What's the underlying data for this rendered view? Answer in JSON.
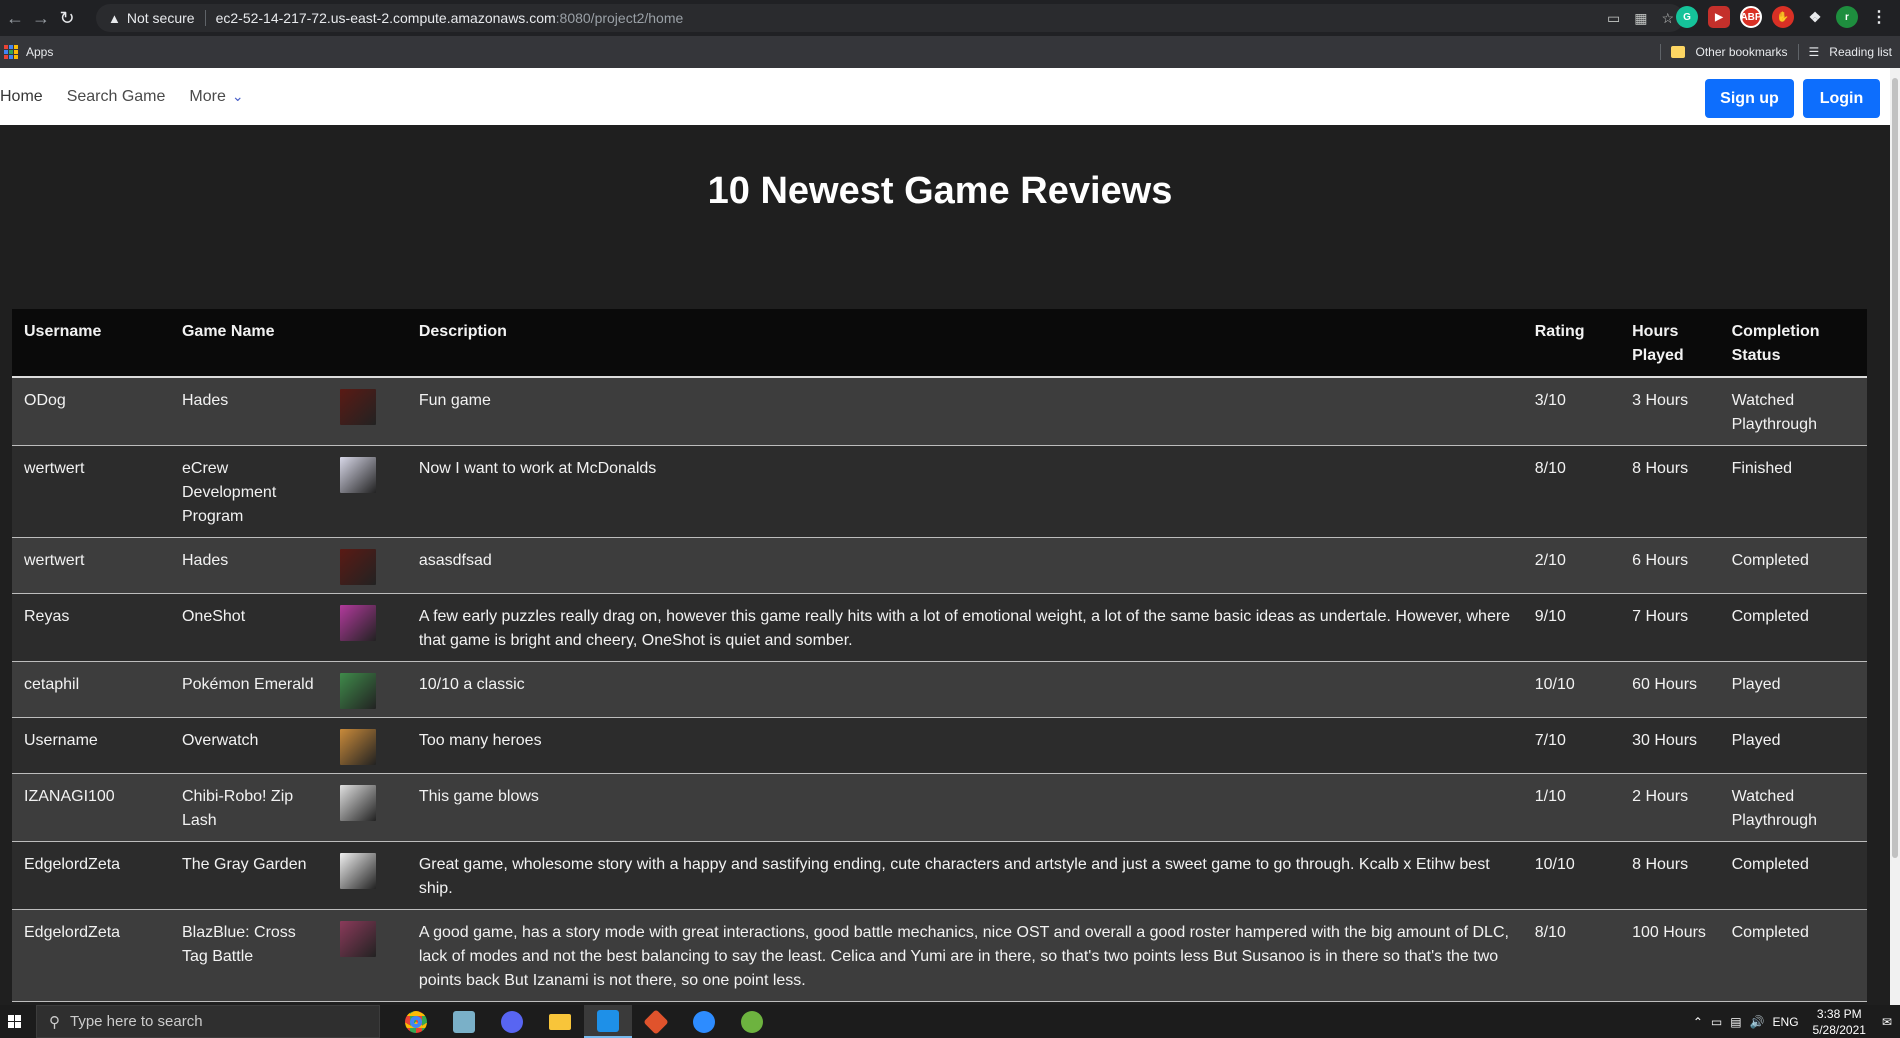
{
  "browser": {
    "security_label": "Not secure",
    "url_host": "ec2-52-14-217-72.us-east-2.compute.amazonaws.com",
    "url_path": ":8080/project2/home",
    "bookmarks_apps": "Apps",
    "other_bookmarks": "Other bookmarks",
    "reading_list": "Reading list"
  },
  "navbar": {
    "home": "Home",
    "search_game": "Search Game",
    "more": "More",
    "signup": "Sign up",
    "login": "Login"
  },
  "page": {
    "title": "10 Newest Game Reviews"
  },
  "table": {
    "headers": {
      "username": "Username",
      "game_name": "Game Name",
      "description": "Description",
      "rating": "Rating",
      "hours_played": "Hours Played",
      "completion_status": "Completion Status"
    },
    "rows": [
      {
        "username": "ODog",
        "game": "Hades",
        "description": "Fun game",
        "rating": "3/10",
        "hours": "3 Hours",
        "status": "Watched Playthrough",
        "thumb_color": "#5a1a14"
      },
      {
        "username": "wertwert",
        "game": "eCrew Development Program",
        "description": "Now I want to work at McDonalds",
        "rating": "8/10",
        "hours": "8 Hours",
        "status": "Finished",
        "thumb_color": "#d8d8e8"
      },
      {
        "username": "wertwert",
        "game": "Hades",
        "description": "asasdfsad",
        "rating": "2/10",
        "hours": "6 Hours",
        "status": "Completed",
        "thumb_color": "#5a1a14"
      },
      {
        "username": "Reyas",
        "game": "OneShot",
        "description": "A few early puzzles really drag on, however this game really hits with a lot of emotional weight, a lot of the same basic ideas as undertale. However, where that game is bright and cheery, OneShot is quiet and somber.",
        "rating": "9/10",
        "hours": "7 Hours",
        "status": "Completed",
        "thumb_color": "#b23a9c"
      },
      {
        "username": "cetaphil",
        "game": "Pokémon Emerald",
        "description": "10/10 a classic",
        "rating": "10/10",
        "hours": "60 Hours",
        "status": "Played",
        "thumb_color": "#3f8a4a"
      },
      {
        "username": "Username",
        "game": "Overwatch",
        "description": "Too many heroes",
        "rating": "7/10",
        "hours": "30 Hours",
        "status": "Played",
        "thumb_color": "#c98a3a"
      },
      {
        "username": "IZANAGI100",
        "game": "Chibi-Robo! Zip Lash",
        "description": "This game blows",
        "rating": "1/10",
        "hours": "2 Hours",
        "status": "Watched Playthrough",
        "thumb_color": "#e0e0e0"
      },
      {
        "username": "EdgelordZeta",
        "game": "The Gray Garden",
        "description": "Great game, wholesome story with a happy and sastifying ending, cute characters and artstyle and just a sweet game to go through. Kcalb x Etihw best ship.",
        "rating": "10/10",
        "hours": "8 Hours",
        "status": "Completed",
        "thumb_color": "#f0f0f0"
      },
      {
        "username": "EdgelordZeta",
        "game": "BlazBlue: Cross Tag Battle",
        "description": "A good game, has a story mode with great interactions, good battle mechanics, nice OST and overall a good roster hampered with the big amount of DLC, lack of modes and not the best balancing to say the least. Celica and Yumi are in there, so that's two points less But Susanoo is in there so that's the two points back But Izanami is not there, so one point less.",
        "rating": "8/10",
        "hours": "100 Hours",
        "status": "Completed",
        "thumb_color": "#8a3a5a"
      }
    ]
  },
  "taskbar": {
    "search_placeholder": "Type here to search",
    "language": "ENG",
    "time": "3:38 PM",
    "date": "5/28/2021"
  },
  "colors": {
    "primary_button": "#0d6efd",
    "page_background": "#1f1f1f"
  }
}
